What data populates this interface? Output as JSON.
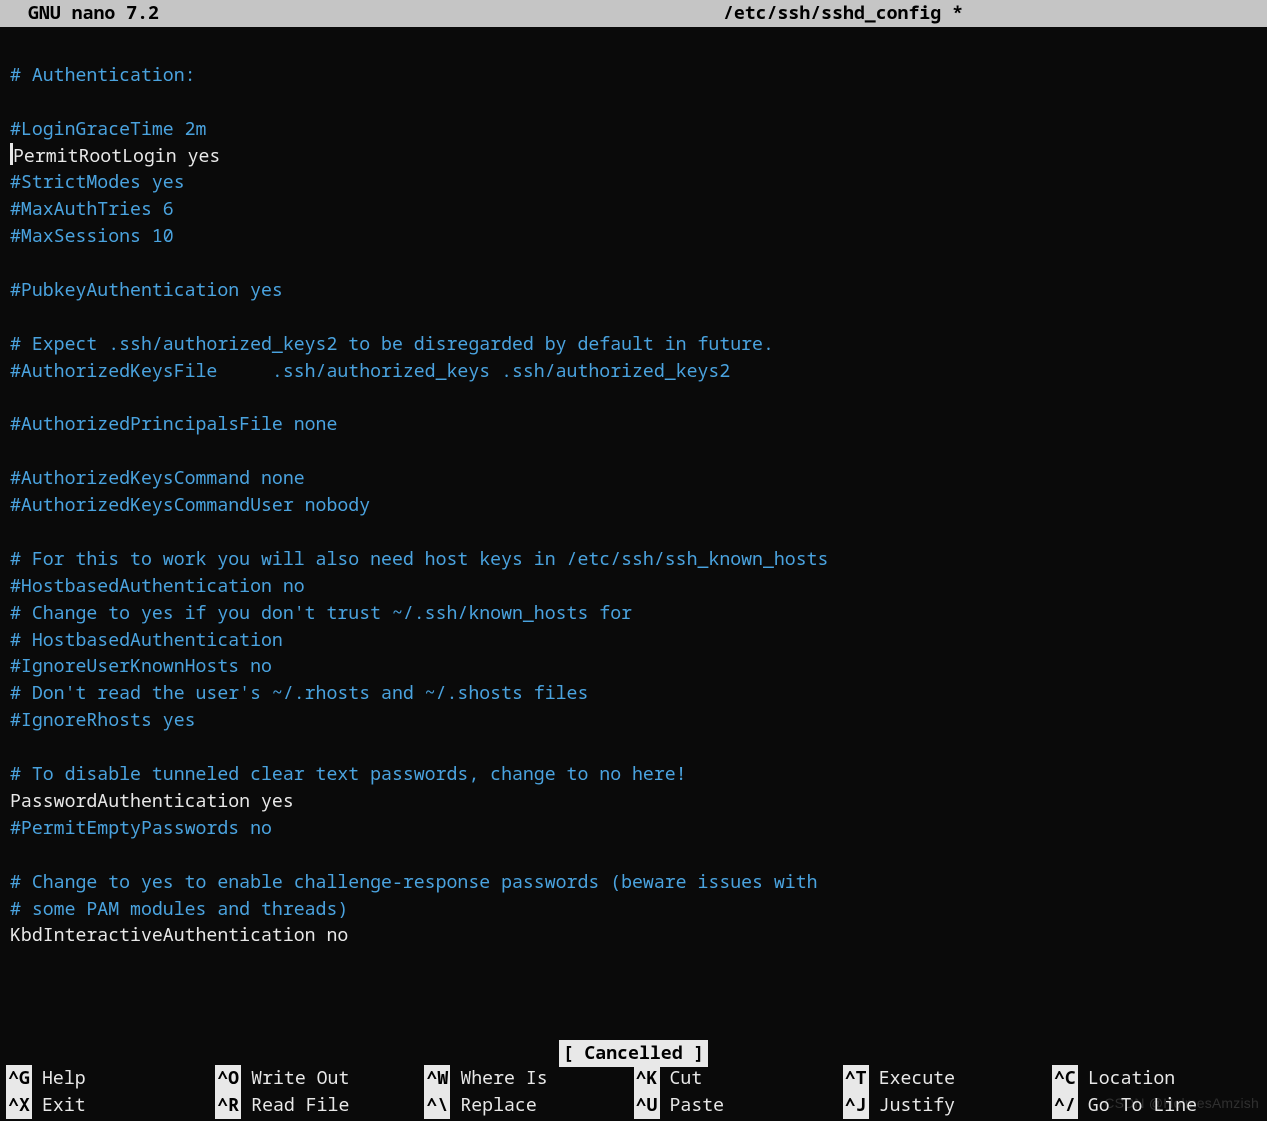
{
  "titlebar": {
    "app": "  GNU nano 7.2",
    "filename": "/etc/ssh/sshd_config *"
  },
  "config_lines": [
    {
      "comment": true,
      "t": ""
    },
    {
      "comment": true,
      "t": "# Authentication:"
    },
    {
      "comment": true,
      "t": ""
    },
    {
      "comment": true,
      "t": "#LoginGraceTime 2m"
    },
    {
      "comment": false,
      "t": "PermitRootLogin yes",
      "cursor": true
    },
    {
      "comment": true,
      "t": "#StrictModes yes"
    },
    {
      "comment": true,
      "t": "#MaxAuthTries 6"
    },
    {
      "comment": true,
      "t": "#MaxSessions 10"
    },
    {
      "comment": true,
      "t": ""
    },
    {
      "comment": true,
      "t": "#PubkeyAuthentication yes"
    },
    {
      "comment": true,
      "t": ""
    },
    {
      "comment": true,
      "t": "# Expect .ssh/authorized_keys2 to be disregarded by default in future."
    },
    {
      "comment": true,
      "t": "#AuthorizedKeysFile     .ssh/authorized_keys .ssh/authorized_keys2"
    },
    {
      "comment": true,
      "t": ""
    },
    {
      "comment": true,
      "t": "#AuthorizedPrincipalsFile none"
    },
    {
      "comment": true,
      "t": ""
    },
    {
      "comment": true,
      "t": "#AuthorizedKeysCommand none"
    },
    {
      "comment": true,
      "t": "#AuthorizedKeysCommandUser nobody"
    },
    {
      "comment": true,
      "t": ""
    },
    {
      "comment": true,
      "t": "# For this to work you will also need host keys in /etc/ssh/ssh_known_hosts"
    },
    {
      "comment": true,
      "t": "#HostbasedAuthentication no"
    },
    {
      "comment": true,
      "t": "# Change to yes if you don't trust ~/.ssh/known_hosts for"
    },
    {
      "comment": true,
      "t": "# HostbasedAuthentication"
    },
    {
      "comment": true,
      "t": "#IgnoreUserKnownHosts no"
    },
    {
      "comment": true,
      "t": "# Don't read the user's ~/.rhosts and ~/.shosts files"
    },
    {
      "comment": true,
      "t": "#IgnoreRhosts yes"
    },
    {
      "comment": true,
      "t": ""
    },
    {
      "comment": true,
      "t": "# To disable tunneled clear text passwords, change to no here!"
    },
    {
      "comment": false,
      "t": "PasswordAuthentication yes"
    },
    {
      "comment": true,
      "t": "#PermitEmptyPasswords no"
    },
    {
      "comment": true,
      "t": ""
    },
    {
      "comment": true,
      "t": "# Change to yes to enable challenge-response passwords (beware issues with"
    },
    {
      "comment": true,
      "t": "# some PAM modules and threads)"
    },
    {
      "comment": false,
      "t": "KbdInteractiveAuthentication no"
    }
  ],
  "status": {
    "message": "[ Cancelled ]"
  },
  "shortcuts": {
    "row1": [
      {
        "key": "^G",
        "desc": "Help"
      },
      {
        "key": "^O",
        "desc": "Write Out"
      },
      {
        "key": "^W",
        "desc": "Where Is"
      },
      {
        "key": "^K",
        "desc": "Cut"
      },
      {
        "key": "^T",
        "desc": "Execute"
      },
      {
        "key": "^C",
        "desc": "Location"
      }
    ],
    "row2": [
      {
        "key": "^X",
        "desc": "Exit"
      },
      {
        "key": "^R",
        "desc": "Read File"
      },
      {
        "key": "^\\",
        "desc": "Replace"
      },
      {
        "key": "^U",
        "desc": "Paste"
      },
      {
        "key": "^J",
        "desc": "Justify"
      },
      {
        "key": "^/",
        "desc": "Go To Line"
      }
    ]
  },
  "watermark": "CSDN @HolmesAmzish"
}
